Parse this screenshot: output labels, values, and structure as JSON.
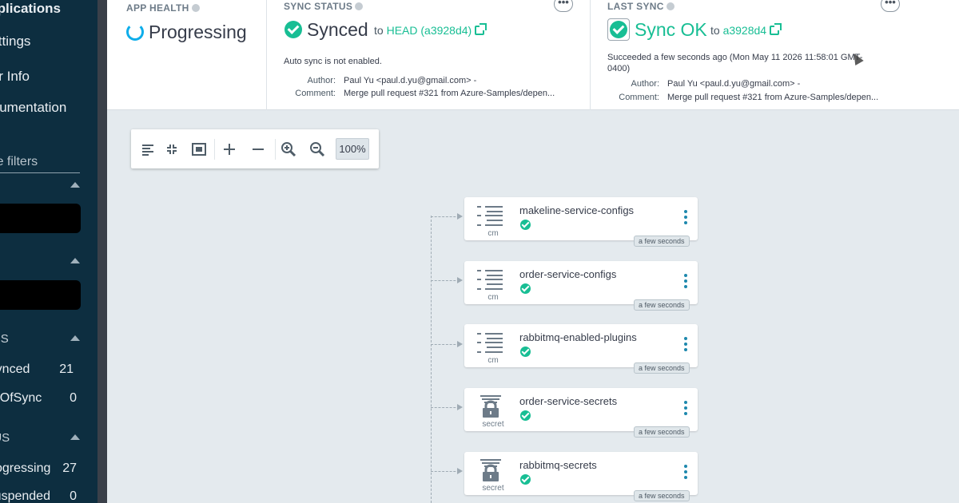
{
  "sidebar": {
    "nav": [
      {
        "label": "Applications"
      },
      {
        "label": "Settings"
      },
      {
        "label": "User Info"
      },
      {
        "label": "Documentation"
      }
    ],
    "filters_label": "Resource filters",
    "sections": [
      {
        "title": "SYNC STATUS",
        "rows": [
          {
            "label": "Synced",
            "count": "21"
          },
          {
            "label": "OutOfSync",
            "count": "0"
          }
        ]
      },
      {
        "title": "HEALTH STATUS",
        "rows": [
          {
            "label": "Progressing",
            "count": "27"
          },
          {
            "label": "Suspended",
            "count": "0"
          }
        ]
      }
    ]
  },
  "header": {
    "app_health": {
      "label": "APP HEALTH",
      "status": "Progressing"
    },
    "sync_status": {
      "label": "SYNC STATUS",
      "status": "Synced",
      "to_text": "to",
      "revision": "HEAD (a3928d4)",
      "note": "Auto sync is not enabled.",
      "author_key": "Author:",
      "author": "Paul Yu <paul.d.yu@gmail.com> -",
      "comment_key": "Comment:",
      "comment": "Merge pull request #321 from Azure-Samples/depen..."
    },
    "last_sync": {
      "label": "LAST SYNC",
      "status": "Sync OK",
      "to_text": "to",
      "revision": "a3928d4",
      "result_line1": "Succeeded a few seconds ago (Mon May 11 2026 11:58:01 GMT-",
      "result_line2": "0400)",
      "author_key": "Author:",
      "author": "Paul Yu <paul.d.yu@gmail.com> -",
      "comment_key": "Comment:",
      "comment": "Merge pull request #321 from Azure-Samples/depen..."
    },
    "more_button": "•••"
  },
  "toolbar": {
    "icons": [
      "align-left-icon",
      "collapse-icon",
      "fit-screen-icon",
      "expand-icon",
      "minus-icon",
      "zoom-in-icon",
      "zoom-out-icon"
    ],
    "zoom": "100%"
  },
  "nodes": [
    {
      "name": "makeline-service-configs",
      "kind": "cm",
      "age": "a few seconds",
      "icon": "configmap-icon",
      "status_color": "#18be94"
    },
    {
      "name": "order-service-configs",
      "kind": "cm",
      "age": "a few seconds",
      "icon": "configmap-icon",
      "status_color": "#18be94"
    },
    {
      "name": "rabbitmq-enabled-plugins",
      "kind": "cm",
      "age": "a few seconds",
      "icon": "configmap-icon",
      "status_color": "#18be94"
    },
    {
      "name": "order-service-secrets",
      "kind": "secret",
      "age": "a few seconds",
      "icon": "secret-icon",
      "status_color": "#18be94"
    },
    {
      "name": "rabbitmq-secrets",
      "kind": "secret",
      "age": "a few seconds",
      "icon": "secret-icon",
      "status_color": "#18be94"
    }
  ],
  "colors": {
    "accent": "#18be94",
    "progressing": "#0dadea",
    "sidebar": "#0d2e40"
  }
}
